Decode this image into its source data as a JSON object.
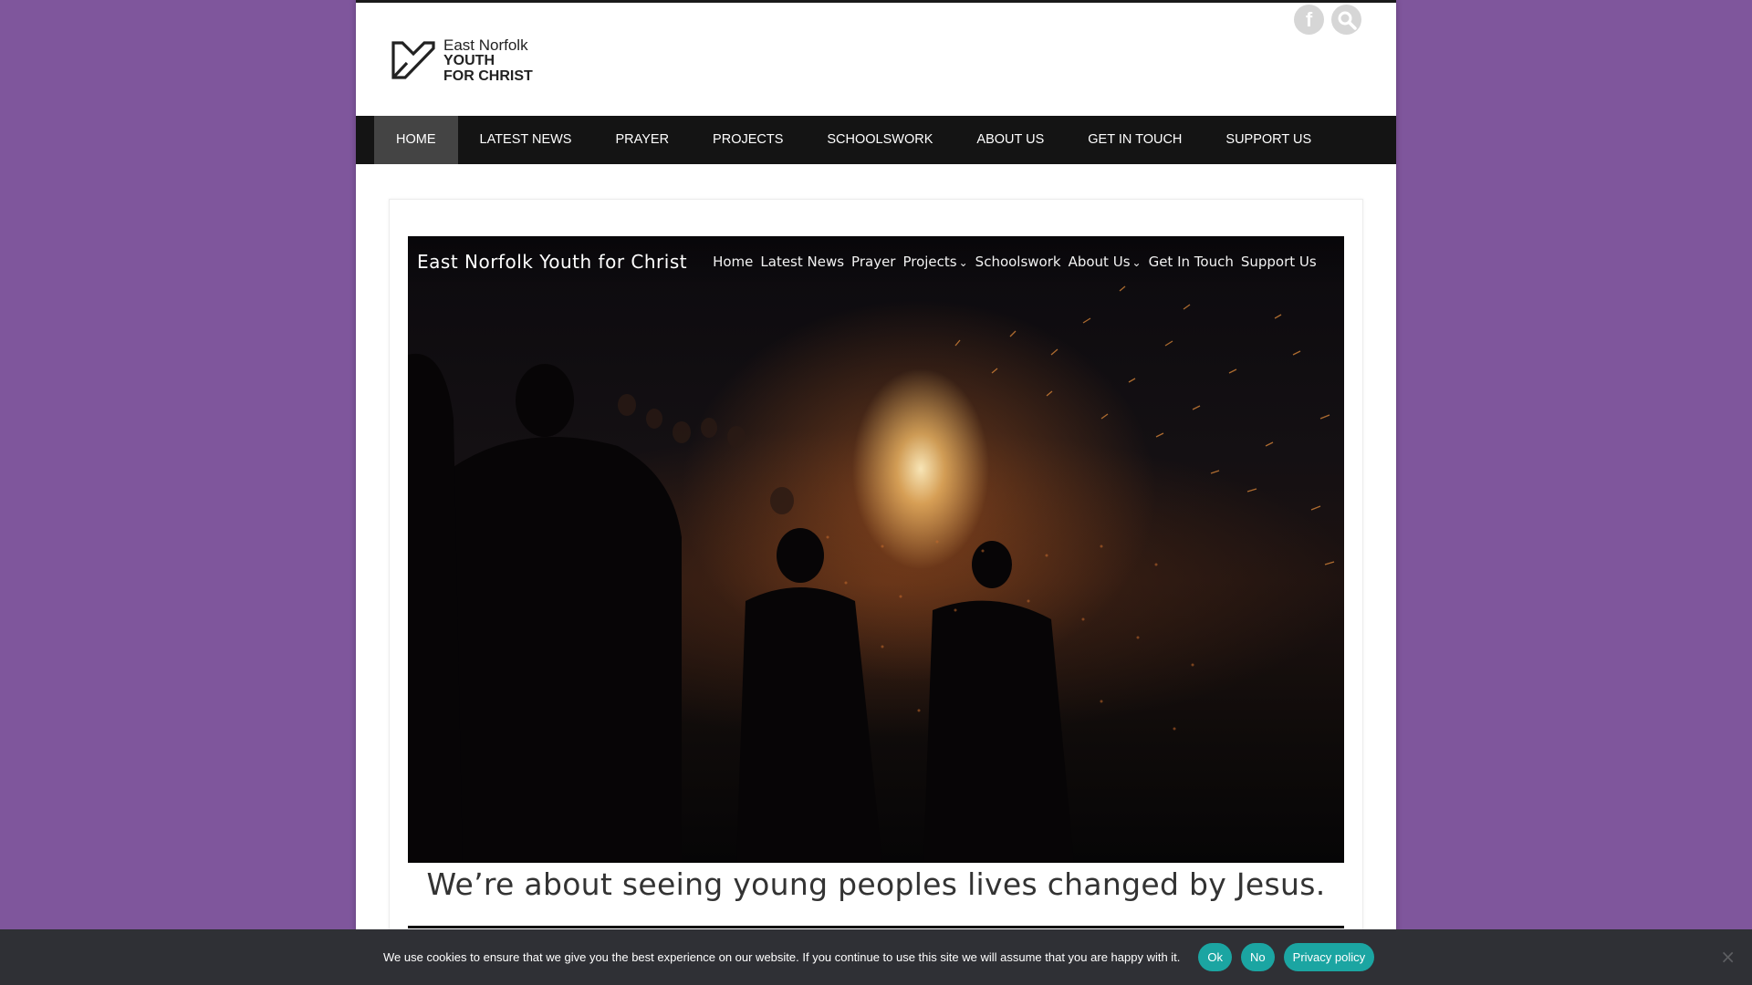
{
  "colors": {
    "page_background": "#7f569c",
    "nav_background": "#141414",
    "nav_active": "#444444",
    "cookie_bar": "#2f3035",
    "cookie_button": "#1ba5a2"
  },
  "header": {
    "logo": {
      "line1": "East Norfolk",
      "line2": "YOUTH",
      "line3": "FOR CHRIST",
      "icon": "heart-outline-logo"
    },
    "social": [
      {
        "icon": "facebook-icon",
        "glyph": "f"
      },
      {
        "icon": "search-icon",
        "glyph": ""
      }
    ]
  },
  "main_nav": {
    "items": [
      {
        "label": "HOME",
        "active": true
      },
      {
        "label": "LATEST NEWS"
      },
      {
        "label": "PRAYER"
      },
      {
        "label": "PROJECTS"
      },
      {
        "label": "SCHOOLSWORK"
      },
      {
        "label": "ABOUT US"
      },
      {
        "label": "GET IN TOUCH"
      },
      {
        "label": "SUPPORT US"
      }
    ]
  },
  "hero": {
    "site_title": "East Norfolk Youth for Christ",
    "links": [
      {
        "label": "Home"
      },
      {
        "label": "Latest News"
      },
      {
        "label": "Prayer"
      },
      {
        "label": "Projects",
        "caret": "⌄"
      },
      {
        "label": "Schoolswork"
      },
      {
        "label": "About Us",
        "caret": "⌄"
      },
      {
        "label": "Get In Touch"
      },
      {
        "label": "Support Us"
      }
    ],
    "image": "bonfire-on-beach-at-night"
  },
  "tagline": "We’re about seeing young peoples lives changed by Jesus.",
  "cookie": {
    "message": "We use cookies to ensure that we give you the best experience on our website. If you continue to use this site we will assume that you are happy with it.",
    "ok": "Ok",
    "no": "No",
    "privacy": "Privacy policy",
    "close_glyph": "×"
  }
}
